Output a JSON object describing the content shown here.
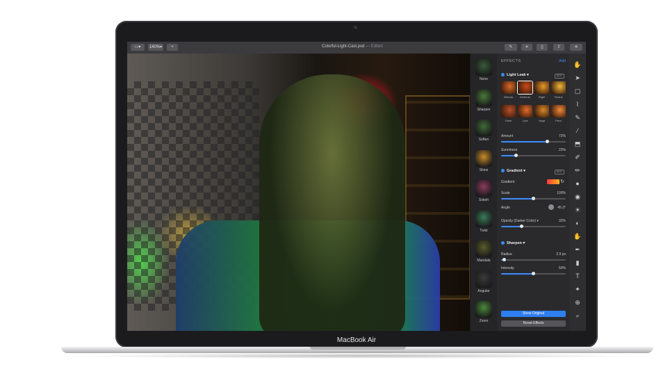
{
  "toolbar": {
    "view_label": "▭▾",
    "zoom_label": "140%▾",
    "add_label": "+",
    "file_name": "Colorful-Light-Cast.psd",
    "file_status": "— Edited"
  },
  "effects_list": [
    {
      "label": "None",
      "color": "#3a5a3a"
    },
    {
      "label": "Sharpen",
      "color": "#4a7a3a"
    },
    {
      "label": "Soften",
      "color": "#3f6a38"
    },
    {
      "label": "Shine",
      "color": "#c98a2a"
    },
    {
      "label": "Sokeh",
      "color": "#8a3a5a"
    },
    {
      "label": "Twist",
      "color": "#3a7a5a"
    },
    {
      "label": "Mandala",
      "color": "#5a5a2a"
    },
    {
      "label": "Angular",
      "color": "#3a3a3a"
    },
    {
      "label": "Zoom",
      "color": "#4a8a3a"
    }
  ],
  "panel": {
    "title": "EFFECTS",
    "add": "Add",
    "edit_tag": "EDIT",
    "light_leak": {
      "title": "Light Leak",
      "presets": [
        {
          "name": "Nebula",
          "color": "#d86a2a"
        },
        {
          "name": "Arcturus",
          "color": "#c84a1a"
        },
        {
          "name": "Rigel",
          "color": "#e89a2a"
        },
        {
          "name": "Taurus",
          "color": "#f0b83a"
        },
        {
          "name": "Orion",
          "color": "#b8502a"
        },
        {
          "name": "Lyra",
          "color": "#e06a2a"
        },
        {
          "name": "Vega",
          "color": "#d8882a"
        },
        {
          "name": "Pavo",
          "color": "#f08a3a"
        }
      ],
      "amount_label": "Amount",
      "amount_value": "72%",
      "amount_level": 0.72,
      "sunniness_label": "Sunniness",
      "sunniness_value": "23%",
      "sunniness_level": 0.23
    },
    "gradient": {
      "title": "Gradient",
      "gradient_label": "Gradient",
      "scale_label": "Scale",
      "scale_value": "100%",
      "scale_level": 0.5,
      "angle_label": "Angle",
      "angle_value": "45.3°",
      "opacity_label": "Opacity (Darker Color)",
      "opacity_value": "32%",
      "opacity_level": 0.32
    },
    "sharpen": {
      "title": "Sharpen",
      "radius_label": "Radius",
      "radius_value": "2.9 px",
      "radius_level": 0.05,
      "intensity_label": "Intensity",
      "intensity_value": "50%",
      "intensity_level": 0.5
    },
    "show_original": "Show Original",
    "reset_effects": "Reset Effects"
  },
  "tools": [
    "✋",
    "➤",
    "▢",
    "⌇",
    "✎",
    "⁄",
    "⬒",
    "✐",
    "✏",
    "●",
    "◉",
    "☀",
    "◐",
    "✋",
    "✒",
    "▮",
    "T",
    "✦",
    "⊕",
    "⌕"
  ],
  "brand": "MacBook Air"
}
